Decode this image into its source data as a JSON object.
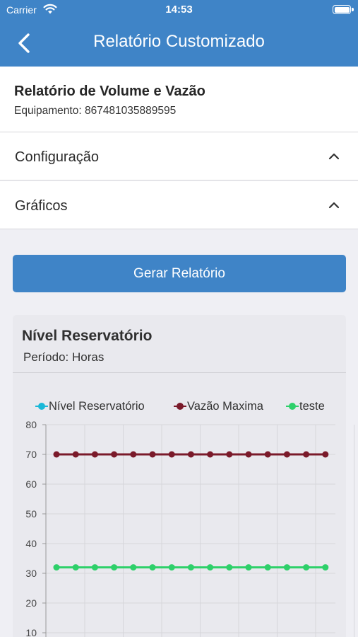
{
  "status_bar": {
    "carrier": "Carrier",
    "time": "14:53"
  },
  "nav": {
    "back_icon": "chevron-left-icon",
    "title": "Relatório Customizado"
  },
  "report": {
    "title": "Relatório de Volume e Vazão",
    "equipment": "Equipamento: 867481035889595"
  },
  "sections": [
    {
      "label": "Configuração",
      "icon": "chevron-up-icon"
    },
    {
      "label": "Gráficos",
      "icon": "chevron-up-icon"
    }
  ],
  "generate_button": {
    "label": "Gerar Relatório"
  },
  "chart_card": {
    "title": "Nível Reservatório",
    "period": "Período: Horas"
  },
  "colors": {
    "primary": "#3f84c7",
    "nivel": "#1ab8d8",
    "vazao": "#7a1a2a",
    "teste": "#2ed06a"
  },
  "chart_data": {
    "type": "line",
    "legend": [
      {
        "name": "Nível Reservatório",
        "color": "#1ab8d8"
      },
      {
        "name": "Vazão Maxima",
        "color": "#7a1a2a"
      },
      {
        "name": "teste",
        "color": "#2ed06a"
      }
    ],
    "y_ticks": [
      "80",
      "70",
      "60",
      "50",
      "40",
      "30",
      "20",
      "10"
    ],
    "ylim": [
      10,
      80
    ],
    "grid": true,
    "legend_position": "top",
    "series": [
      {
        "name": "Vazão Maxima",
        "color": "#7a1a2a",
        "values": [
          70,
          70,
          70,
          70,
          70,
          70,
          70,
          70,
          70,
          70,
          70,
          70,
          70,
          70,
          70
        ]
      },
      {
        "name": "teste",
        "color": "#2ed06a",
        "values": [
          32,
          32,
          32,
          32,
          32,
          32,
          32,
          32,
          32,
          32,
          32,
          32,
          32,
          32,
          32
        ]
      }
    ]
  }
}
